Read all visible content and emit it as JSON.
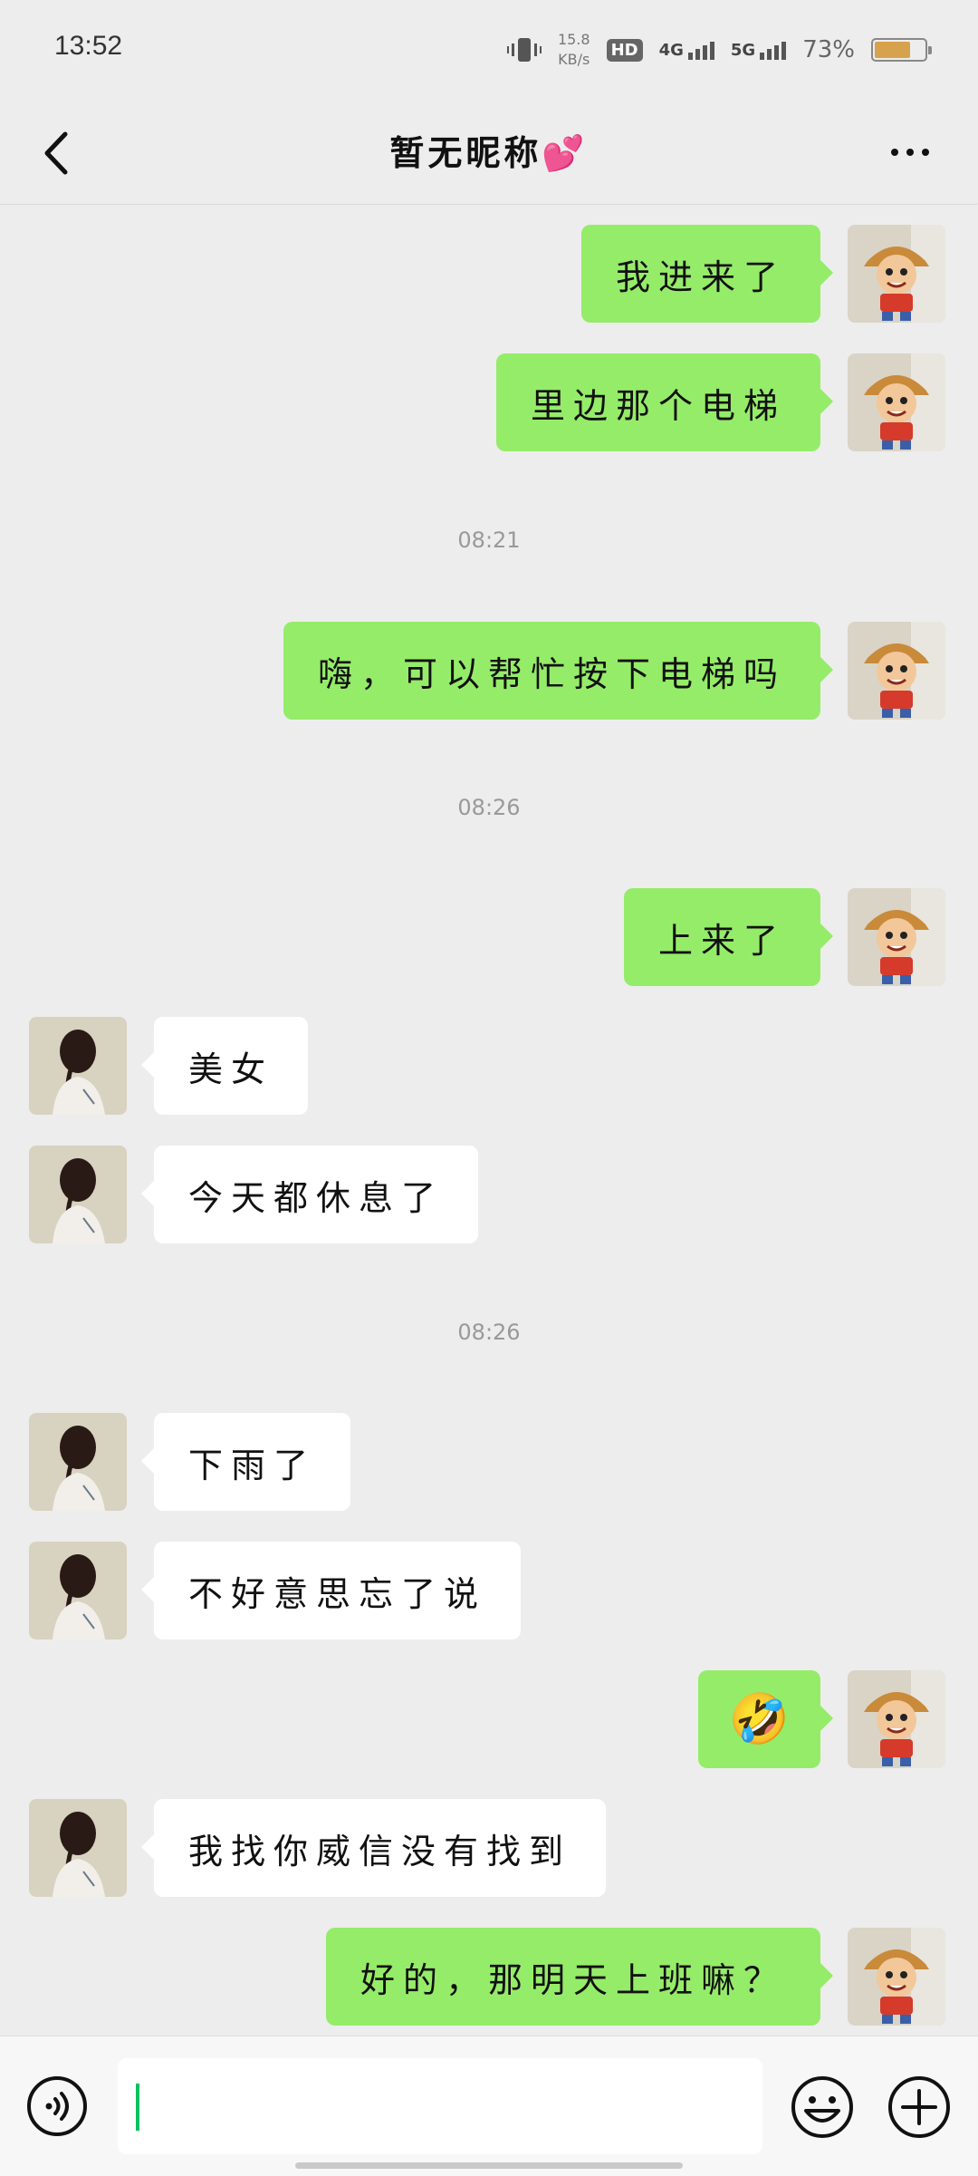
{
  "status_bar": {
    "time": "13:52",
    "net_speed_value": "15.8",
    "net_speed_unit": "KB/s",
    "hd_badge": "HD",
    "sig1_label": "4G",
    "sig2_label": "5G",
    "battery_percent": "73%",
    "battery_level": 0.73
  },
  "header": {
    "title": "暂无昵称💕"
  },
  "messages": [
    {
      "side": "right",
      "text": "我进来了"
    },
    {
      "side": "right",
      "text": "里边那个电梯"
    },
    {
      "timestamp": "08:21"
    },
    {
      "side": "right",
      "text": "嗨，可以帮忙按下电梯吗"
    },
    {
      "timestamp": "08:26"
    },
    {
      "side": "right",
      "text": "上来了"
    },
    {
      "side": "left",
      "text": "美女"
    },
    {
      "side": "left",
      "text": "今天都休息了"
    },
    {
      "timestamp": "08:26"
    },
    {
      "side": "left",
      "text": "下雨了"
    },
    {
      "side": "left",
      "text": "不好意思忘了说"
    },
    {
      "side": "right",
      "text": "🤣"
    },
    {
      "side": "left",
      "text": "我找你威信没有找到"
    },
    {
      "side": "right",
      "text": "好的，那明天上班嘛？"
    }
  ],
  "input": {
    "value": ""
  },
  "colors": {
    "sent_bubble": "#95ec69",
    "received_bubble": "#ffffff",
    "background": "#ededed",
    "caret": "#07c160"
  }
}
